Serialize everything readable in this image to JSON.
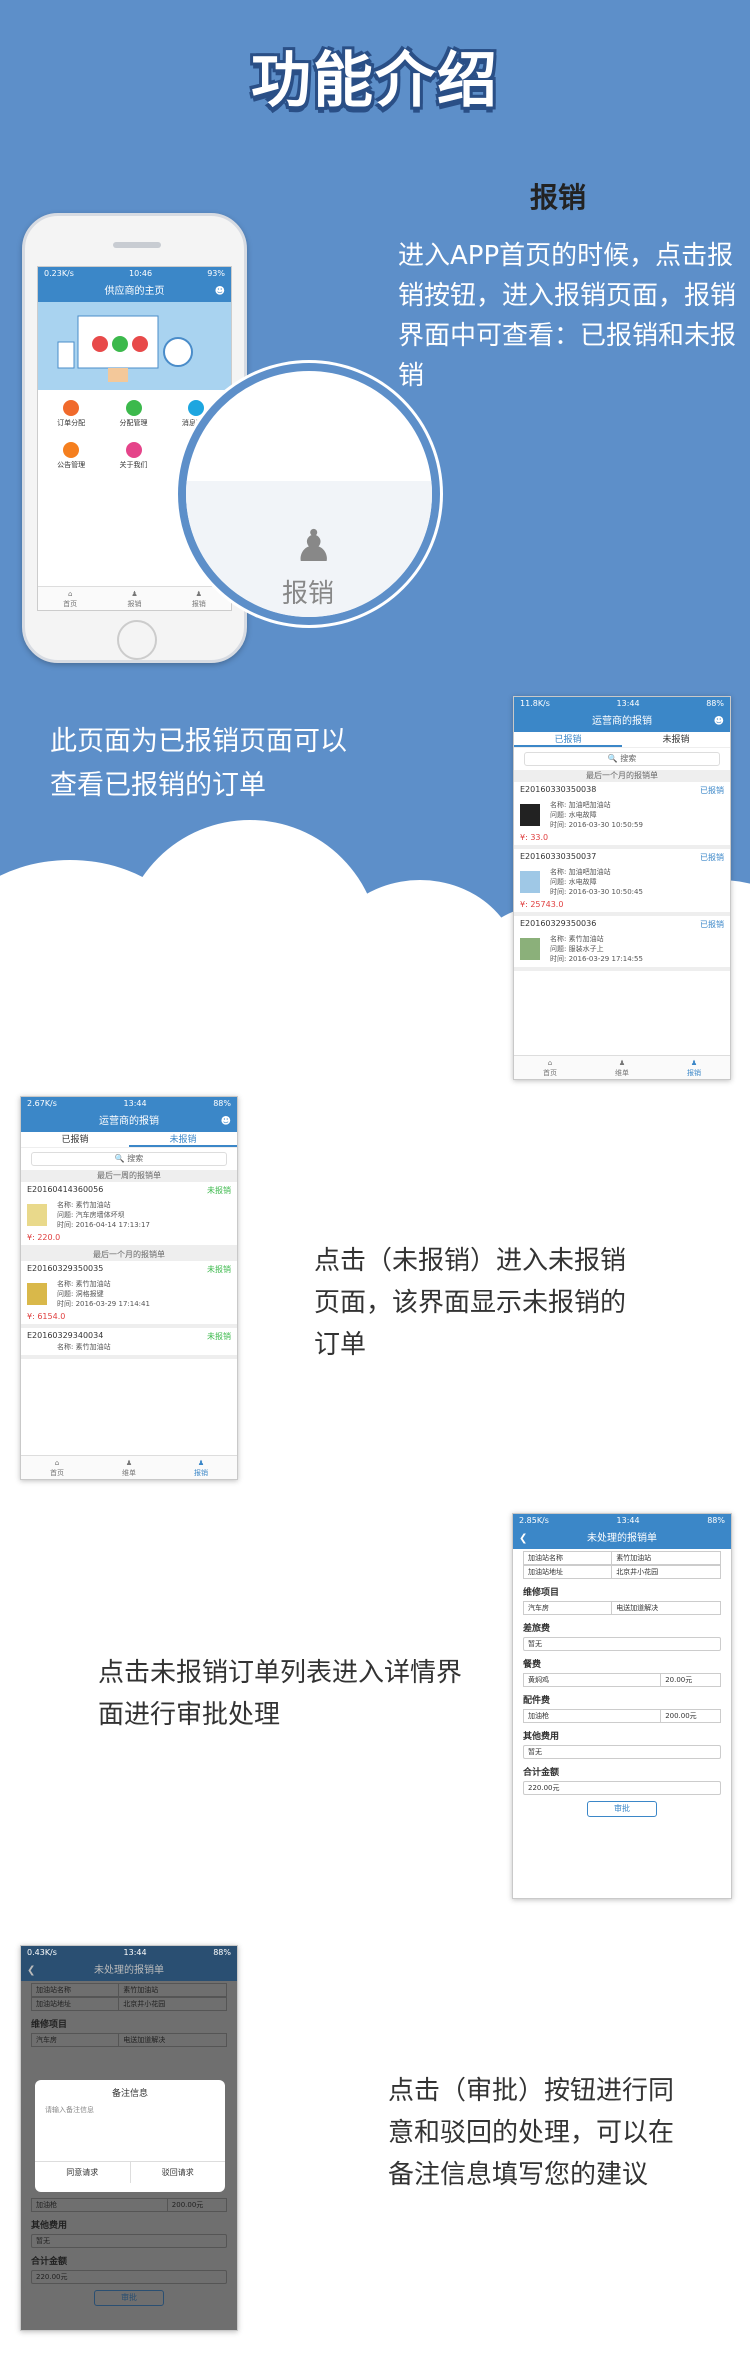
{
  "page_title": "功能介绍",
  "section1": {
    "heading": "报销",
    "desc": "进入APP首页的时候，点击报销按钮，进入报销页面，报销界面中可查看：已报销和未报销"
  },
  "phone": {
    "status_left": "0.23K/s",
    "status_time": "10:46",
    "status_right": "93%",
    "title": "供应商的主页",
    "grid": [
      {
        "label": "订单分配",
        "color": "#f06a2c",
        "icon": "order-icon"
      },
      {
        "label": "分配管理",
        "color": "#3cb94c",
        "icon": "manage-icon"
      },
      {
        "label": "消息通知",
        "color": "#1ea6e0",
        "icon": "message-icon"
      },
      {
        "label": "公告管理",
        "color": "#f57f1f",
        "icon": "announce-icon"
      },
      {
        "label": "关于我们",
        "color": "#e5448a",
        "icon": "about-icon"
      }
    ],
    "tabbar": [
      "首页",
      "报销",
      "报销"
    ]
  },
  "zoom": {
    "label": "报销",
    "icon": "expense-icon"
  },
  "section2": {
    "desc": "此页面为已报销页面可以查看已报销的订单"
  },
  "shot1": {
    "status_left": "11.8K/s",
    "status_time": "13:44",
    "status_right": "88%",
    "title": "运营商的报销",
    "tab_done": "已报销",
    "tab_undone": "未报销",
    "search": "搜索",
    "group": "最后一个月的报销单",
    "orders": [
      {
        "id": "E20160330350038",
        "status": "已报销",
        "name": "名称: 加油吧加油站",
        "issue": "问题: 水电故障",
        "time": "时间: 2016-03-30 10:50:59",
        "price": "¥: 33.0"
      },
      {
        "id": "E20160330350037",
        "status": "已报销",
        "name": "名称: 加油吧加油站",
        "issue": "问题: 水电故障",
        "time": "时间: 2016-03-30 10:50:45",
        "price": "¥: 25743.0"
      },
      {
        "id": "E20160329350036",
        "status": "已报销",
        "name": "名称: 素竹加油站",
        "issue": "问题: 服装水子上",
        "time": "时间: 2016-03-29 17:14:55",
        "price": ""
      }
    ],
    "tabbar": [
      "首页",
      "维单",
      "报销"
    ]
  },
  "shot2": {
    "status_left": "2.67K/s",
    "status_time": "13:44",
    "status_right": "88%",
    "title": "运营商的报销",
    "tab_done": "已报销",
    "tab_undone": "未报销",
    "search": "搜索",
    "group1": "最后一周的报销单",
    "group2": "最后一个月的报销单",
    "orders": [
      {
        "id": "E20160414360056",
        "status": "未报销",
        "name": "名称: 素竹加油站",
        "issue": "问题: 汽车房墙体坏坝",
        "time": "时间: 2016-04-14 17:13:17",
        "price": "¥: 220.0"
      },
      {
        "id": "E20160329350035",
        "status": "未报销",
        "name": "名称: 素竹加油站",
        "issue": "问题: 洞格报键",
        "time": "时间: 2016-03-29 17:14:41",
        "price": "¥: 6154.0"
      },
      {
        "id": "E20160329340034",
        "status": "未报销",
        "name": "名称: 素竹加油站",
        "issue": "",
        "time": "",
        "price": ""
      }
    ],
    "tabbar": [
      "首页",
      "维单",
      "报销"
    ]
  },
  "section3": {
    "desc": "点击（未报销）进入未报销页面，该界面显示未报销的订单"
  },
  "shot3": {
    "status_left": "2.85K/s",
    "status_time": "13:44",
    "status_right": "88%",
    "title": "未处理的报销单",
    "station_name_label": "加油站名称",
    "station_name": "素竹加油站",
    "station_addr_label": "加油站地址",
    "station_addr": "北京井小花园",
    "repair_label": "维修项目",
    "repair_key": "汽车房",
    "repair_val": "电送加道解决",
    "travel_label": "差旅费",
    "travel_val": "暂无",
    "meal_label": "餐费",
    "meal_key": "黄焖鸡",
    "meal_val": "20.00元",
    "parts_label": "配件费",
    "parts_key": "加油枪",
    "parts_val": "200.00元",
    "other_label": "其他费用",
    "other_val": "暂无",
    "total_label": "合计金额",
    "total_val": "220.00元",
    "approve": "审批"
  },
  "section4": {
    "desc": "点击未报销订单列表进入详情界面进行审批处理"
  },
  "shot4": {
    "status_left": "0.43K/s",
    "status_time": "13:44",
    "status_right": "88%",
    "title": "未处理的报销单",
    "station_name_label": "加油站名称",
    "station_name": "素竹加油站",
    "station_addr_label": "加油站地址",
    "station_addr": "北京井小花园",
    "repair_label": "维修项目",
    "repair_key": "汽车房",
    "repair_val": "电送加道解决",
    "dialog_title": "备注信息",
    "dialog_placeholder": "请输入备注信息",
    "agree": "同意请求",
    "reject": "驳回请求",
    "parts_key": "加油枪",
    "parts_val": "200.00元",
    "other_label": "其他费用",
    "other_val": "暂无",
    "total_label": "合计金额",
    "total_val": "220.00元",
    "approve": "审批"
  },
  "section5": {
    "desc": "点击（审批）按钮进行同意和驳回的处理，可以在备注信息填写您的建议"
  }
}
